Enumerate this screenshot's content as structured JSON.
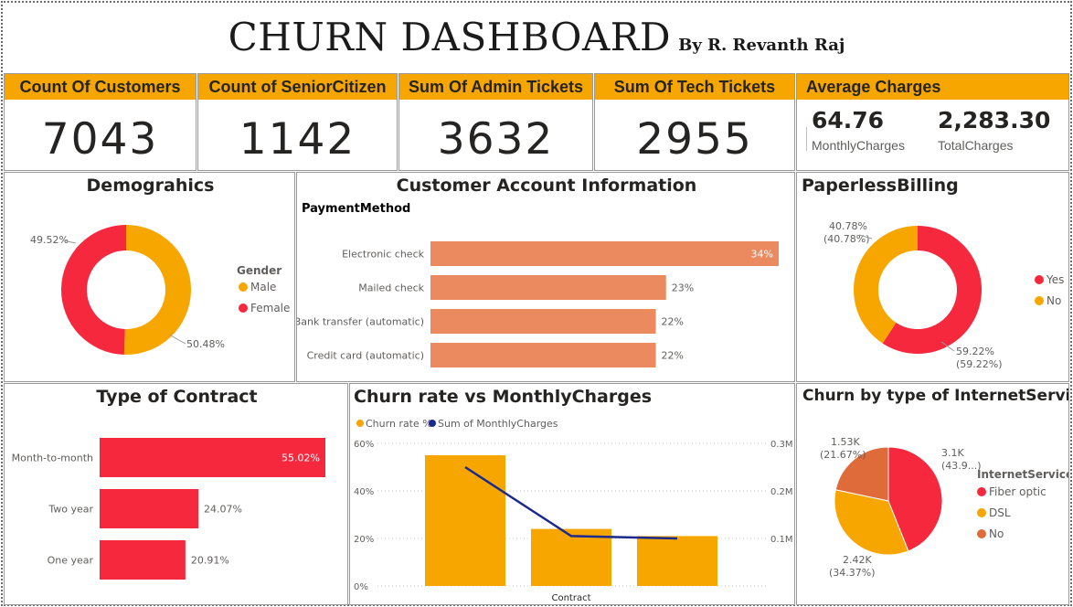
{
  "header": {
    "title": "CHURN DASHBOARD",
    "byline": "By R. Revanth Raj"
  },
  "kpis": [
    {
      "label": "Count Of Customers",
      "value": "7043"
    },
    {
      "label": "Count of SeniorCitizen",
      "value": "1142"
    },
    {
      "label": "Sum Of Admin Tickets",
      "value": "3632"
    },
    {
      "label": "Sum Of Tech Tickets",
      "value": "2955"
    }
  ],
  "average_charges": {
    "label": "Average Charges",
    "monthly_value": "64.76",
    "monthly_label": "MonthlyCharges",
    "total_value": "2,283.30",
    "total_label": "TotalCharges"
  },
  "colors": {
    "orange": "#f7a600",
    "red": "#f5283e",
    "salmon": "#eb895f",
    "navy": "#1a2a8e",
    "darkorange": "#e06b3a"
  },
  "chart_data": [
    {
      "id": "demographics",
      "type": "pie",
      "title": "Demograhics",
      "legend_title": "Gender",
      "legend_position": "right",
      "categories": [
        "Male",
        "Female"
      ],
      "values": [
        50.48,
        49.52
      ],
      "labels": [
        "50.48%",
        "49.52%"
      ],
      "colors": [
        "#f7a600",
        "#f5283e"
      ]
    },
    {
      "id": "account",
      "type": "bar",
      "title": "Customer Account Information",
      "subtitle": "PaymentMethod",
      "categories": [
        "Electronic check",
        "Mailed check",
        "Bank transfer (automatic)",
        "Credit card (automatic)"
      ],
      "values": [
        34,
        23,
        22,
        22
      ],
      "labels": [
        "34%",
        "23%",
        "22%",
        "22%"
      ],
      "xlim": [
        0,
        34
      ],
      "color": "#eb895f"
    },
    {
      "id": "paperless",
      "type": "pie",
      "title": "PaperlessBilling",
      "legend_position": "right",
      "categories": [
        "Yes",
        "No"
      ],
      "values": [
        59.22,
        40.78
      ],
      "labels": [
        "59.22%",
        "40.78%"
      ],
      "labels2": [
        "(59.22%)",
        "(40.78%)"
      ],
      "colors": [
        "#f5283e",
        "#f7a600"
      ]
    },
    {
      "id": "contract",
      "type": "bar",
      "title": "Type of Contract",
      "categories": [
        "Month-to-month",
        "Two year",
        "One year"
      ],
      "values": [
        55.02,
        24.07,
        20.91
      ],
      "labels": [
        "55.02%",
        "24.07%",
        "20.91%"
      ],
      "xlim": [
        0,
        55.02
      ],
      "color": "#f5283e"
    },
    {
      "id": "churn_monthly",
      "type": "bar",
      "title": "Churn rate vs MonthlyCharges",
      "legend": [
        "Churn rate %",
        "Sum of MonthlyCharges"
      ],
      "legend_position": "top-left",
      "xlabel": "Contract",
      "churn_rate": [
        55,
        24,
        21
      ],
      "monthly_charges": [
        0.25,
        0.105,
        0.1
      ],
      "ylim_left": [
        0,
        60
      ],
      "yticks_left": [
        "0%",
        "20%",
        "40%",
        "60%"
      ],
      "ylim_right": [
        0.0,
        0.3
      ],
      "yticks_right": [
        "0.1M",
        "0.2M",
        "0.3M"
      ],
      "grid": true
    },
    {
      "id": "internet",
      "type": "pie",
      "title": "Churn by type of InternetService",
      "legend_title": "InternetService",
      "legend_position": "right",
      "categories": [
        "Fiber optic",
        "DSL",
        "No"
      ],
      "values": [
        43.96,
        34.37,
        21.67
      ],
      "labels": [
        "3.1K",
        "2.42K",
        "1.53K"
      ],
      "labels2": [
        "(43.9...)",
        "(34.37%)",
        "(21.67%)"
      ],
      "colors": [
        "#f5283e",
        "#f7a600",
        "#e06b3a"
      ]
    }
  ]
}
